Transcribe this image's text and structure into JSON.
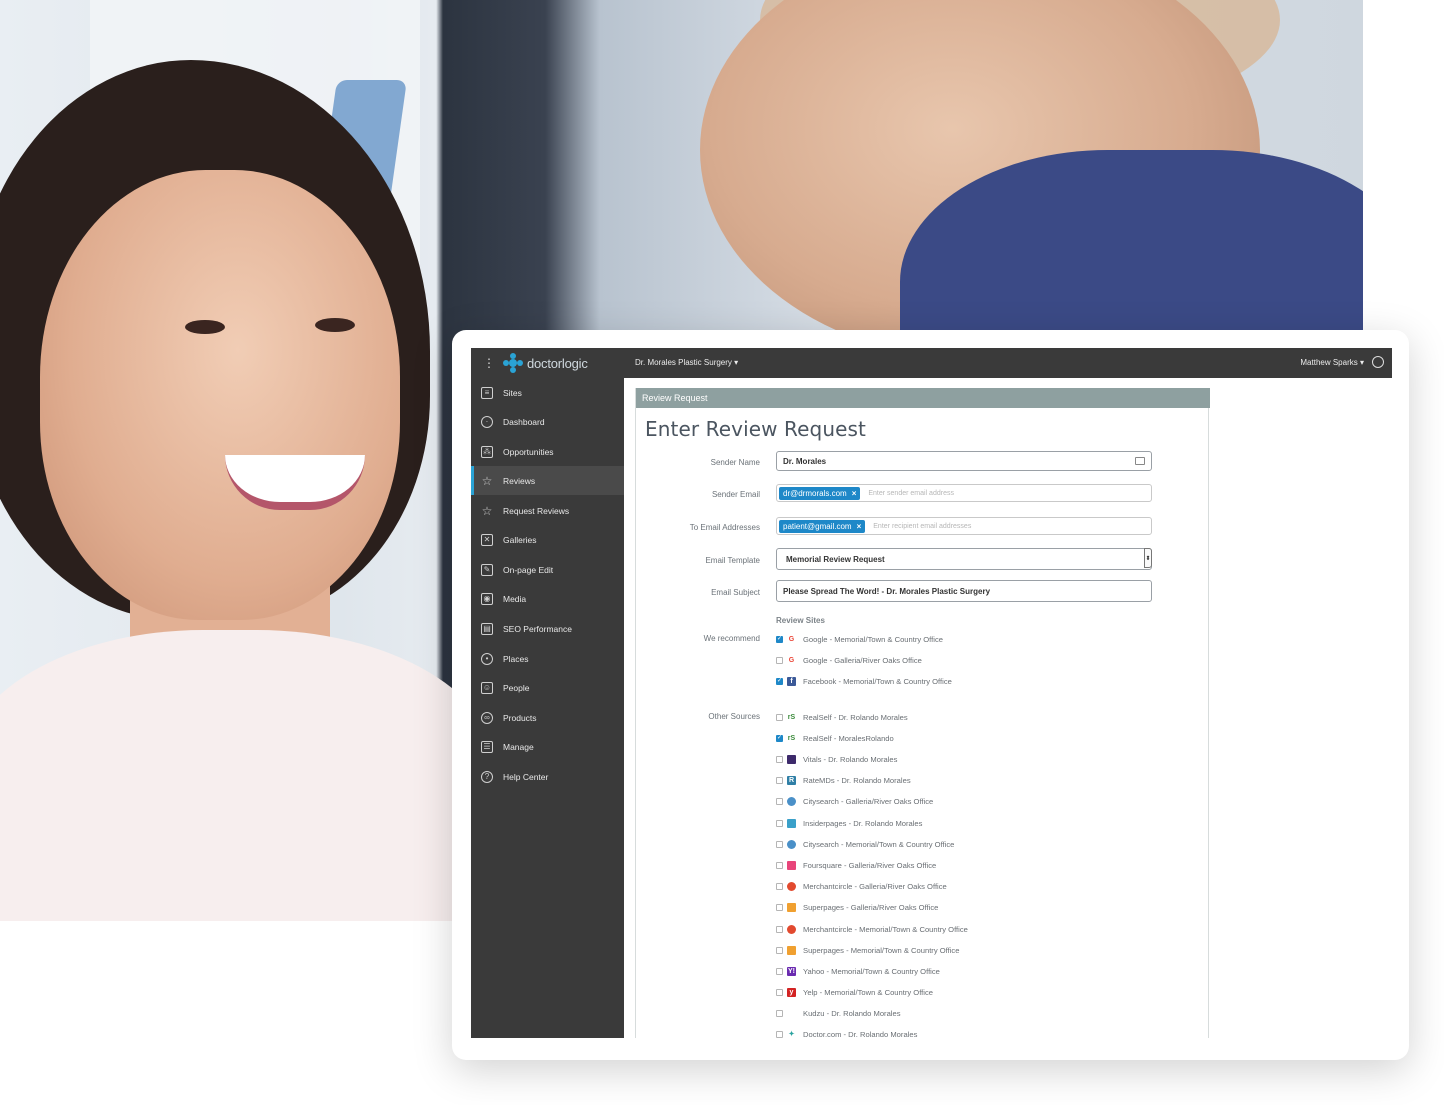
{
  "colors": {
    "accent": "#2aa3d5",
    "tag_blue": "#1e88c8",
    "sidebar_bg": "#3a3a3a",
    "panel_header": "#8ea0a0"
  },
  "brand": {
    "logo_text": "doctorlogic"
  },
  "topbar": {
    "practice_selector": "Dr. Morales Plastic Surgery",
    "user_name": "Matthew Sparks"
  },
  "sidebar": {
    "items": [
      {
        "label": "Sites",
        "icon": "sites-icon"
      },
      {
        "label": "Dashboard",
        "icon": "dashboard-icon"
      },
      {
        "label": "Opportunities",
        "icon": "opportunities-icon"
      },
      {
        "label": "Reviews",
        "icon": "star-icon",
        "active": true
      },
      {
        "label": "Request Reviews",
        "icon": "star-icon"
      },
      {
        "label": "Galleries",
        "icon": "galleries-icon"
      },
      {
        "label": "On-page Edit",
        "icon": "edit-icon"
      },
      {
        "label": "Media",
        "icon": "camera-icon"
      },
      {
        "label": "SEO Performance",
        "icon": "chart-icon"
      },
      {
        "label": "Places",
        "icon": "pin-icon"
      },
      {
        "label": "People",
        "icon": "people-icon"
      },
      {
        "label": "Products",
        "icon": "products-icon"
      },
      {
        "label": "Manage",
        "icon": "sliders-icon"
      },
      {
        "label": "Help Center",
        "icon": "help-icon"
      }
    ]
  },
  "panel": {
    "header": "Review Request",
    "title": "Enter Review Request"
  },
  "form": {
    "sender_name": {
      "label": "Sender Name",
      "value": "Dr. Morales"
    },
    "sender_email": {
      "label": "Sender Email",
      "tag": "dr@drmorals.com",
      "placeholder": "Enter sender email address"
    },
    "to_email": {
      "label": "To Email Addresses",
      "tag": "patient@gmail.com",
      "placeholder": "Enter recipient email addresses"
    },
    "email_template": {
      "label": "Email Template",
      "value": "Memorial Review Request"
    },
    "email_subject": {
      "label": "Email Subject",
      "value": "Please Spread The Word! - Dr. Morales Plastic Surgery"
    }
  },
  "review_sites": {
    "title": "Review Sites",
    "recommend_label": "We recommend",
    "other_label": "Other Sources",
    "recommended": [
      {
        "label": "Google - Memorial/Town & Country Office",
        "checked": true,
        "icon": "google-icon"
      },
      {
        "label": "Google - Galleria/River Oaks Office",
        "checked": false,
        "icon": "google-icon"
      },
      {
        "label": "Facebook - Memorial/Town & Country Office",
        "checked": true,
        "icon": "facebook-icon"
      }
    ],
    "other": [
      {
        "label": "RealSelf - Dr. Rolando Morales",
        "checked": false,
        "icon": "realself-icon"
      },
      {
        "label": "RealSelf - MoralesRolando",
        "checked": true,
        "icon": "realself-icon"
      },
      {
        "label": "Vitals - Dr. Rolando Morales",
        "checked": false,
        "icon": "vitals-icon"
      },
      {
        "label": "RateMDs - Dr. Rolando Morales",
        "checked": false,
        "icon": "ratemds-icon"
      },
      {
        "label": "Citysearch - Galleria/River Oaks Office",
        "checked": false,
        "icon": "citysearch-icon"
      },
      {
        "label": "Insiderpages - Dr. Rolando Morales",
        "checked": false,
        "icon": "insiderpages-icon"
      },
      {
        "label": "Citysearch - Memorial/Town & Country Office",
        "checked": false,
        "icon": "citysearch-icon"
      },
      {
        "label": "Foursquare - Galleria/River Oaks Office",
        "checked": false,
        "icon": "foursquare-icon"
      },
      {
        "label": "Merchantcircle - Galleria/River Oaks Office",
        "checked": false,
        "icon": "merchantcircle-icon"
      },
      {
        "label": "Superpages - Galleria/River Oaks Office",
        "checked": false,
        "icon": "superpages-icon"
      },
      {
        "label": "Merchantcircle - Memorial/Town & Country Office",
        "checked": false,
        "icon": "merchantcircle-icon"
      },
      {
        "label": "Superpages - Memorial/Town & Country Office",
        "checked": false,
        "icon": "superpages-icon"
      },
      {
        "label": "Yahoo - Memorial/Town & Country Office",
        "checked": false,
        "icon": "yahoo-icon"
      },
      {
        "label": "Yelp - Memorial/Town & Country Office",
        "checked": false,
        "icon": "yelp-icon"
      },
      {
        "label": "Kudzu - Dr. Rolando Morales",
        "checked": false,
        "icon": "kudzu-icon"
      },
      {
        "label": "Doctor.com - Dr. Rolando Morales",
        "checked": false,
        "icon": "doctorcom-icon"
      }
    ]
  }
}
